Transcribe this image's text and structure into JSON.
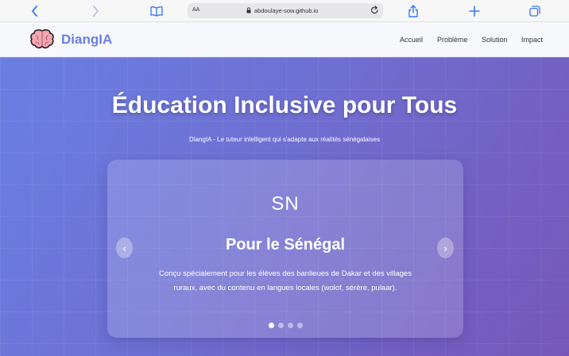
{
  "browser": {
    "url": "abdoulaye-sow.github.io",
    "aa_label": "AA",
    "accent_color": "#3478f6"
  },
  "header": {
    "brand_name": "DiangIA",
    "brand_color": "#6a7ee6",
    "nav": [
      "Accueil",
      "Problème",
      "Solution",
      "Impact"
    ]
  },
  "hero": {
    "title": "Éducation Inclusive pour Tous",
    "subtitle": "DiangIA - Le tuteur intelligent qui s'adapte aux réalités sénégalaises",
    "gradient": [
      "#6a7fe2",
      "#7657b8"
    ]
  },
  "carousel": {
    "flag_text": "SN",
    "title": "Pour le Sénégal",
    "description": "Conçu spécialement pour les élèves des banlieues de Dakar et des villages ruraux, avec du contenu en langues locales (wolof, sérère, pulaar).",
    "prev_label": "‹",
    "next_label": "›",
    "slide_count": 4,
    "active_slide": 1
  }
}
